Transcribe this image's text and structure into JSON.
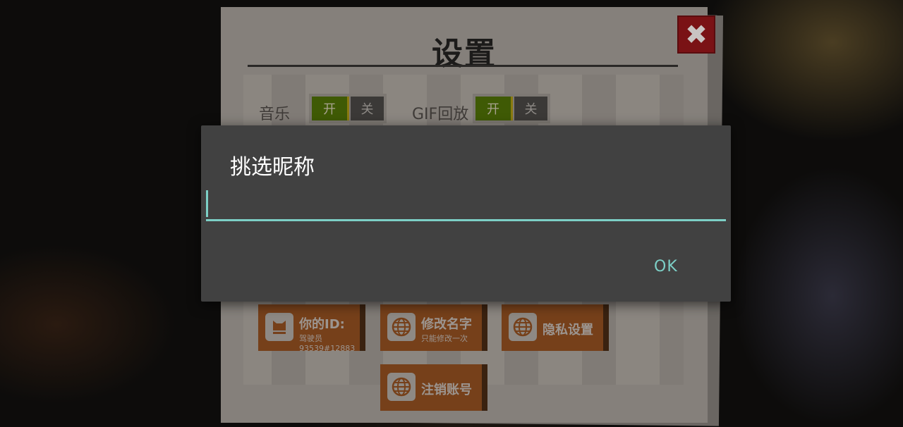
{
  "settings": {
    "title": "设置",
    "music_label": "音乐",
    "gif_label": "GIF回放",
    "music_toggle": {
      "on": "开",
      "off": "关"
    },
    "gif_toggle": {
      "on": "开",
      "off": "关"
    },
    "id_button": {
      "line1": "你的ID:",
      "line2": "驾驶员93539#12883"
    },
    "rename_button": {
      "line1": "修改名字",
      "line2": "只能修改一次"
    },
    "privacy_button": {
      "label": "隐私设置"
    },
    "delete_account_button": {
      "label": "注销账号"
    },
    "close_icon": "close-icon"
  },
  "dialog": {
    "title": "挑选昵称",
    "input_value": "",
    "ok_label": "OK"
  },
  "colors": {
    "dialog_bg": "#414141",
    "accent": "#7ccfc6",
    "toggle_on": "#3f5a05",
    "button_orange": "#76401a",
    "close_red": "#7a1215"
  }
}
